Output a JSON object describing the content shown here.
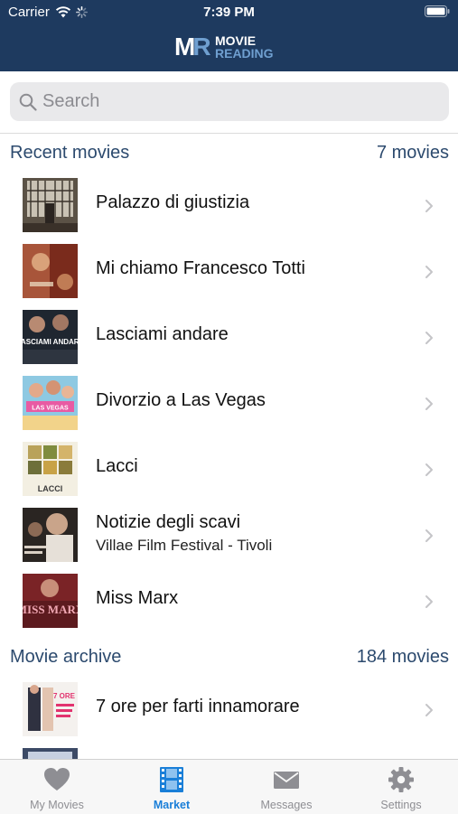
{
  "status_bar": {
    "carrier": "Carrier",
    "time": "7:39 PM"
  },
  "header": {
    "logo_mark_m": "M",
    "logo_mark_r": "R",
    "logo_line1": "MOVIE",
    "logo_line2": "READING"
  },
  "search": {
    "placeholder": "Search",
    "value": ""
  },
  "sections": [
    {
      "title": "Recent movies",
      "count": "7 movies"
    },
    {
      "title": "Movie archive",
      "count": "184 movies"
    }
  ],
  "recent_movies": [
    {
      "title": "Palazzo di giustizia"
    },
    {
      "title": "Mi chiamo Francesco Totti"
    },
    {
      "title": "Lasciami andare",
      "poster_text": "LASCIAMI ANDARE"
    },
    {
      "title": "Divorzio a Las Vegas",
      "poster_text": "LAS VEGAS"
    },
    {
      "title": "Lacci",
      "poster_text": "LACCI"
    },
    {
      "title": "Notizie degli scavi",
      "subtitle": "Villae Film Festival - Tivoli"
    },
    {
      "title": "Miss Marx",
      "poster_text": "MISS MARX"
    }
  ],
  "archive_movies": [
    {
      "title": "7 ore per farti innamorare",
      "poster_text": "7 ORE"
    }
  ],
  "tabbar": [
    {
      "label": "My Movies",
      "icon": "heart-icon"
    },
    {
      "label": "Market",
      "icon": "film-icon"
    },
    {
      "label": "Messages",
      "icon": "envelope-icon"
    },
    {
      "label": "Settings",
      "icon": "gear-icon"
    }
  ],
  "colors": {
    "header_bg": "#1e3a5f",
    "section_text": "#2c4a6e",
    "tab_active": "#1a7fd8",
    "tab_inactive": "#8e8e93"
  }
}
